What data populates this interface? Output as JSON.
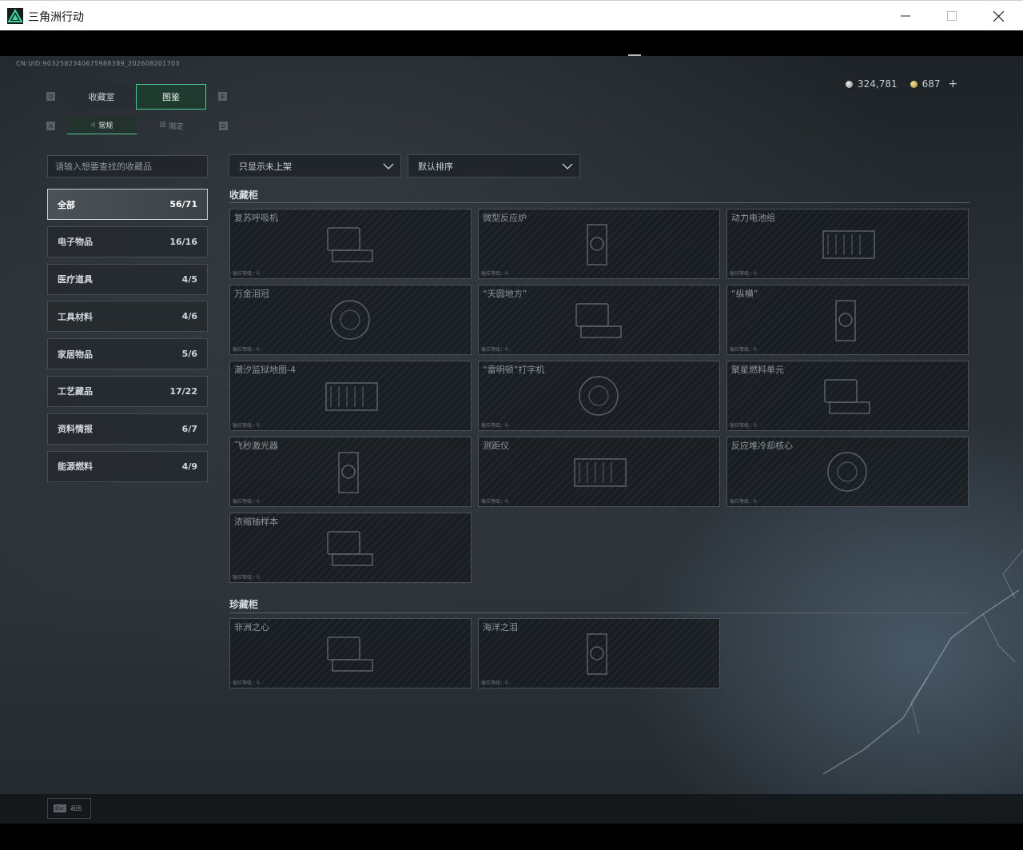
{
  "window": {
    "title": "三角洲行动",
    "minimize_icon": "minimize-icon",
    "maximize_icon": "maximize-icon",
    "close_icon": "close-icon"
  },
  "uid": "CN:UID:9032582340675988389_202608201703",
  "currency": {
    "silver": "324,781",
    "gold": "687",
    "add_label": "+"
  },
  "keys": {
    "prev_main": "Q",
    "next_main": "E",
    "prev_sub": "A",
    "next_sub": "D"
  },
  "main_tabs": [
    {
      "label": "收藏室",
      "active": false
    },
    {
      "label": "图鉴",
      "active": true
    }
  ],
  "sub_tabs": [
    {
      "label": "常规",
      "active": true
    },
    {
      "label": "限定",
      "active": false
    }
  ],
  "search": {
    "placeholder": "请输入想要查找的收藏品"
  },
  "categories": [
    {
      "label": "全部",
      "count": "56/71",
      "active": true
    },
    {
      "label": "电子物品",
      "count": "16/16"
    },
    {
      "label": "医疗道具",
      "count": "4/5"
    },
    {
      "label": "工具材料",
      "count": "4/6"
    },
    {
      "label": "家居物品",
      "count": "5/6"
    },
    {
      "label": "工艺藏品",
      "count": "17/22"
    },
    {
      "label": "资料情报",
      "count": "6/7"
    },
    {
      "label": "能源燃料",
      "count": "4/9"
    }
  ],
  "filter": {
    "value": "只显示未上架"
  },
  "sort": {
    "value": "默认排序"
  },
  "sections": [
    {
      "title": "收藏柜",
      "items": [
        {
          "name": "复苏呼吸机",
          "level": "展位等级：0"
        },
        {
          "name": "微型反应炉",
          "level": "展位等级：0"
        },
        {
          "name": "动力电池组",
          "level": "展位等级：0"
        },
        {
          "name": "万金泪冠",
          "level": "展位等级：0"
        },
        {
          "name": "“天圆地方”",
          "level": "展位等级：0"
        },
        {
          "name": "“纵横”",
          "level": "展位等级：0"
        },
        {
          "name": "潮汐监狱地图-4",
          "level": "展位等级：0"
        },
        {
          "name": "“雷明顿”打字机",
          "level": "展位等级：0"
        },
        {
          "name": "聚星燃料单元",
          "level": "展位等级：0"
        },
        {
          "name": "飞秒激光器",
          "level": "展位等级：0"
        },
        {
          "name": "测距仪",
          "level": "展位等级：0"
        },
        {
          "name": "反应堆冷却核心",
          "level": "展位等级：0"
        },
        {
          "name": "浓缩铀样本",
          "level": "展位等级：0"
        }
      ]
    },
    {
      "title": "珍藏柜",
      "items": [
        {
          "name": "非洲之心",
          "level": "展位等级：0"
        },
        {
          "name": "海洋之泪",
          "level": "展位等级：0"
        }
      ]
    }
  ],
  "footer": {
    "esc_key": "Esc",
    "back_label": "返回"
  }
}
